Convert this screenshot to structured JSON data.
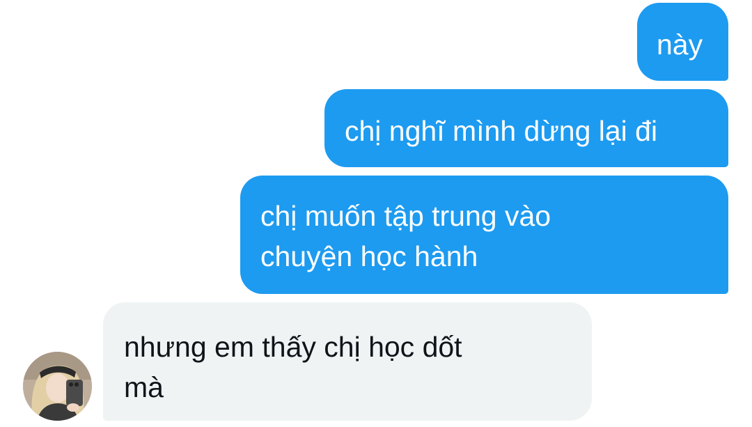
{
  "conversation": {
    "messages": [
      {
        "sender": "self",
        "text": "này"
      },
      {
        "sender": "self",
        "text": "chị nghĩ mình dừng lại đi"
      },
      {
        "sender": "self",
        "text": "chị muốn tập trung vào\nchuyện học hành"
      },
      {
        "sender": "other",
        "text": "nhưng em thấy chị học dốt\nmà"
      }
    ]
  },
  "theme": {
    "sent_bubble_color": "#1d9bf0",
    "received_bubble_color": "#eff3f4",
    "sent_text_color": "#ffffff",
    "received_text_color": "#0f1419"
  },
  "avatar": {
    "icon": "user-avatar-photo"
  }
}
